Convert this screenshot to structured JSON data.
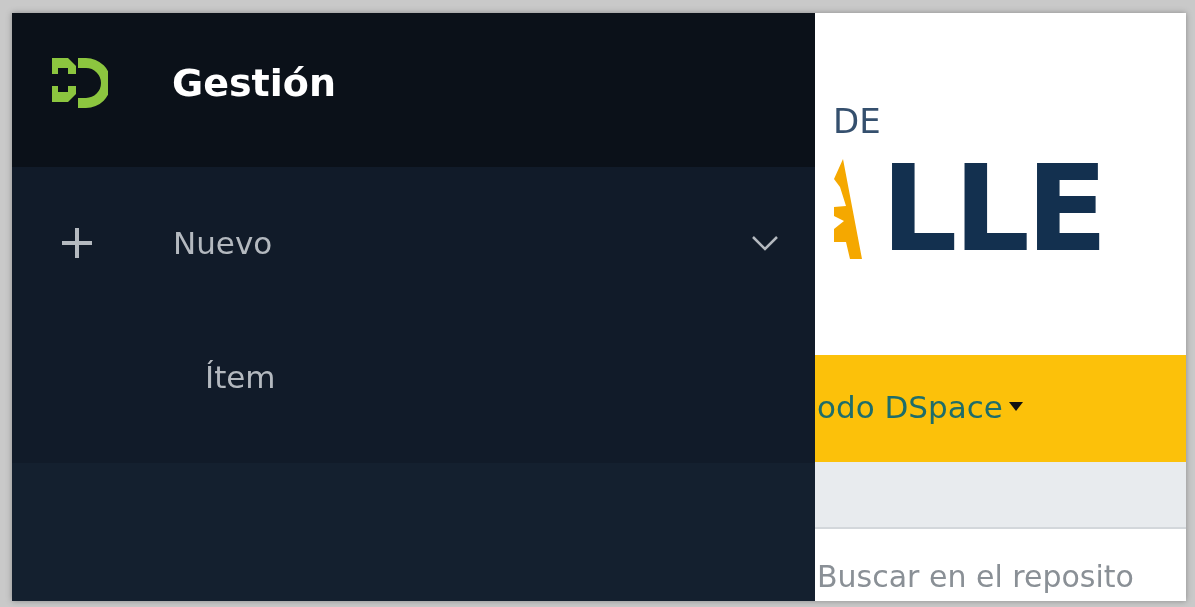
{
  "sidebar": {
    "title": "Gestión",
    "menu": [
      {
        "label": "Nuevo",
        "expanded": true,
        "children": [
          {
            "label": "Ítem"
          }
        ]
      }
    ]
  },
  "page": {
    "logo": {
      "top_text": "DE",
      "main_text": "LLE"
    },
    "nav": {
      "label": "odo DSpace"
    },
    "search": {
      "placeholder": "Buscar en el reposito"
    }
  }
}
